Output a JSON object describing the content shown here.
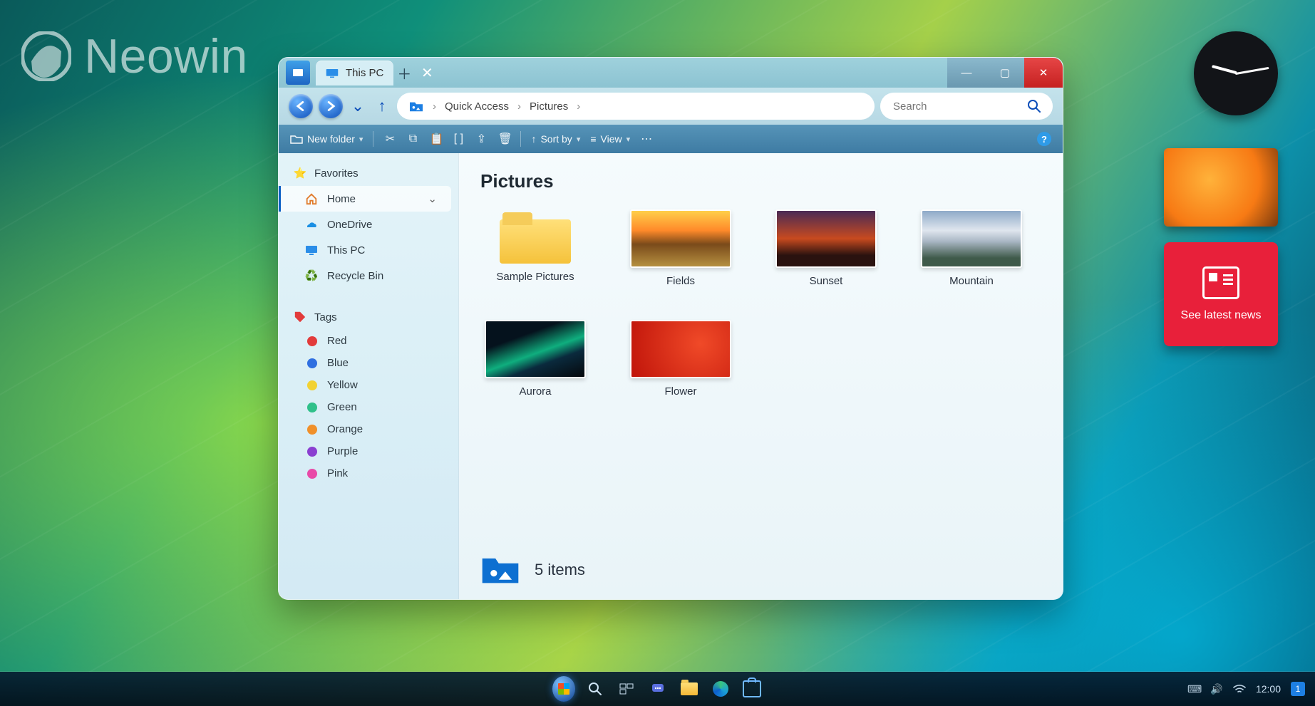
{
  "watermark": "Neowin",
  "window": {
    "tab_title": "This PC",
    "breadcrumbs": [
      "Quick Access",
      "Pictures"
    ],
    "search_placeholder": "Search",
    "toolbar": {
      "new_folder": "New folder",
      "sort_by": "Sort by",
      "view": "View"
    },
    "sidebar": {
      "favorites": "Favorites",
      "items": [
        {
          "label": "Home",
          "icon": "home-icon",
          "selected": true,
          "expandable": true
        },
        {
          "label": "OneDrive",
          "icon": "onedrive-icon"
        },
        {
          "label": "This PC",
          "icon": "thispc-icon"
        },
        {
          "label": "Recycle Bin",
          "icon": "recycle-icon"
        }
      ],
      "tags_header": "Tags",
      "tags": [
        {
          "label": "Red",
          "color": "#e23b3b"
        },
        {
          "label": "Blue",
          "color": "#2f6fe0"
        },
        {
          "label": "Yellow",
          "color": "#f2d233"
        },
        {
          "label": "Green",
          "color": "#2fc08a"
        },
        {
          "label": "Orange",
          "color": "#f0902a"
        },
        {
          "label": "Purple",
          "color": "#8a3fd1"
        },
        {
          "label": "Pink",
          "color": "#e84aa8"
        }
      ]
    },
    "main": {
      "heading": "Pictures",
      "items": [
        {
          "label": "Sample Pictures",
          "type": "folder"
        },
        {
          "label": "Fields",
          "type": "image",
          "thumb": "th-fields"
        },
        {
          "label": "Sunset",
          "type": "image",
          "thumb": "th-sunset"
        },
        {
          "label": "Mountain",
          "type": "image",
          "thumb": "th-mountain"
        },
        {
          "label": "Aurora",
          "type": "image",
          "thumb": "th-aurora"
        },
        {
          "label": "Flower",
          "type": "image",
          "thumb": "th-flower"
        }
      ],
      "status_text": "5 items"
    }
  },
  "gadgets": {
    "news_label": "See latest news"
  },
  "taskbar": {
    "time": "12:00",
    "notification_count": "1"
  }
}
